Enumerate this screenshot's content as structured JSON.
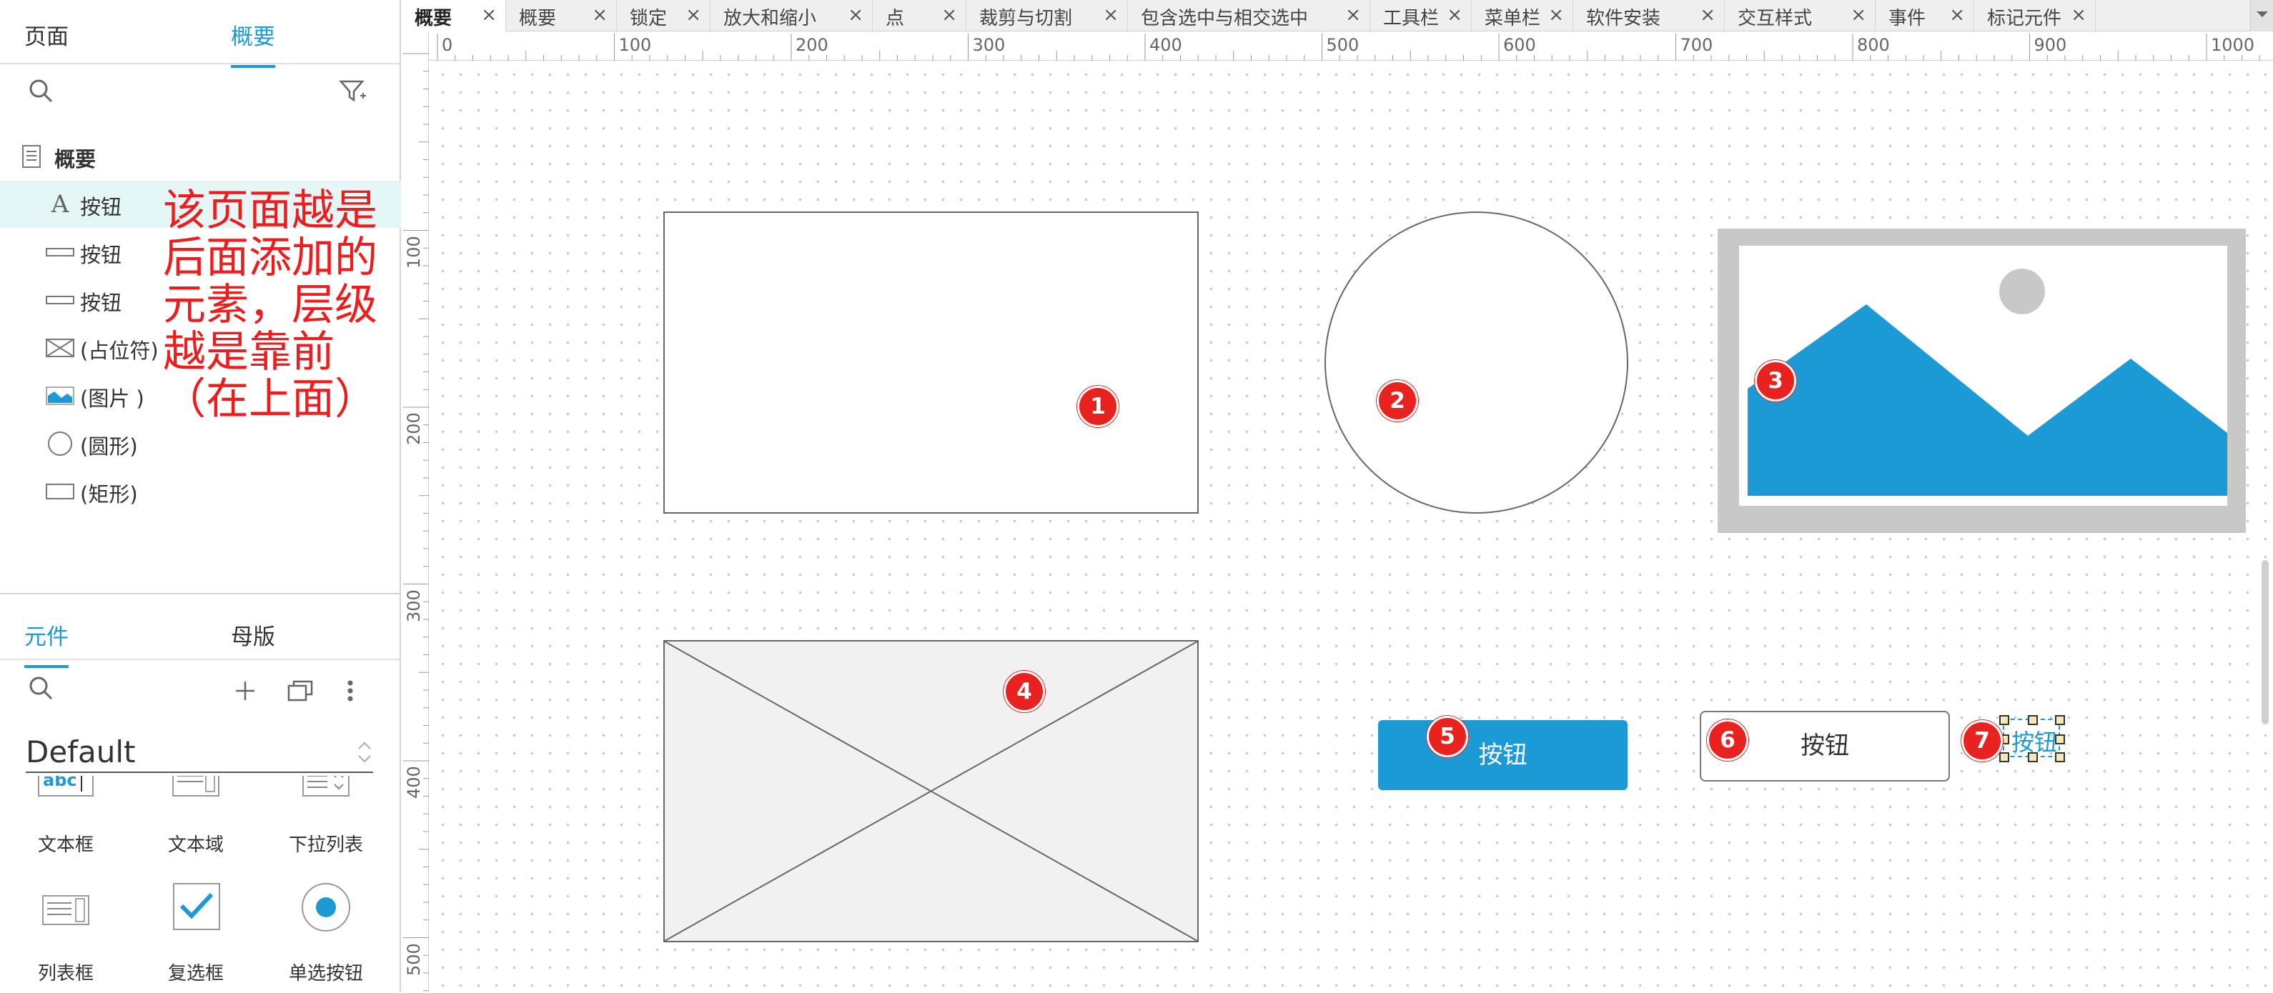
{
  "left_panel": {
    "tabs": [
      "页面",
      "概要"
    ],
    "active_tab": "概要",
    "outline_root": "概要",
    "outline_items": [
      {
        "label": "按钮",
        "icon": "text-icon"
      },
      {
        "label": "按钮",
        "icon": "button-icon"
      },
      {
        "label": "按钮",
        "icon": "button-icon"
      },
      {
        "label": "(占位符)",
        "icon": "placeholder-icon"
      },
      {
        "label": "(图片 )",
        "icon": "image-icon"
      },
      {
        "label": "(圆形)",
        "icon": "circle-icon"
      },
      {
        "label": "(矩形)",
        "icon": "rectangle-icon"
      }
    ],
    "annotation": "该页面越是\n后面添加的\n元素，层级\n越是靠前\n（在上面）"
  },
  "library_panel": {
    "tabs": [
      "元件",
      "母版"
    ],
    "active_tab": "元件",
    "library_name": "Default",
    "widgets": [
      "文本框",
      "文本域",
      "下拉列表",
      "列表框",
      "复选框",
      "单选按钮"
    ]
  },
  "doc_tabs": [
    "概要",
    "概要",
    "锁定",
    "放大和缩小",
    "点",
    "裁剪与切割",
    "包含选中与相交选中",
    "工具栏",
    "菜单栏",
    "软件安装",
    "交互样式",
    "事件",
    "标记元件"
  ],
  "ruler": {
    "h_ticks": [
      "0",
      "100",
      "200",
      "300",
      "400",
      "500",
      "600",
      "700",
      "800",
      "900",
      "1000"
    ],
    "v_ticks": [
      "100",
      "200",
      "300",
      "400",
      "500"
    ]
  },
  "canvas": {
    "button_label": "按钮",
    "markers": [
      "1",
      "2",
      "3",
      "4",
      "5",
      "6",
      "7"
    ]
  },
  "colors": {
    "accent": "#1c9ad6",
    "marker": "#e8231f",
    "annotation": "#ee1c1c"
  }
}
